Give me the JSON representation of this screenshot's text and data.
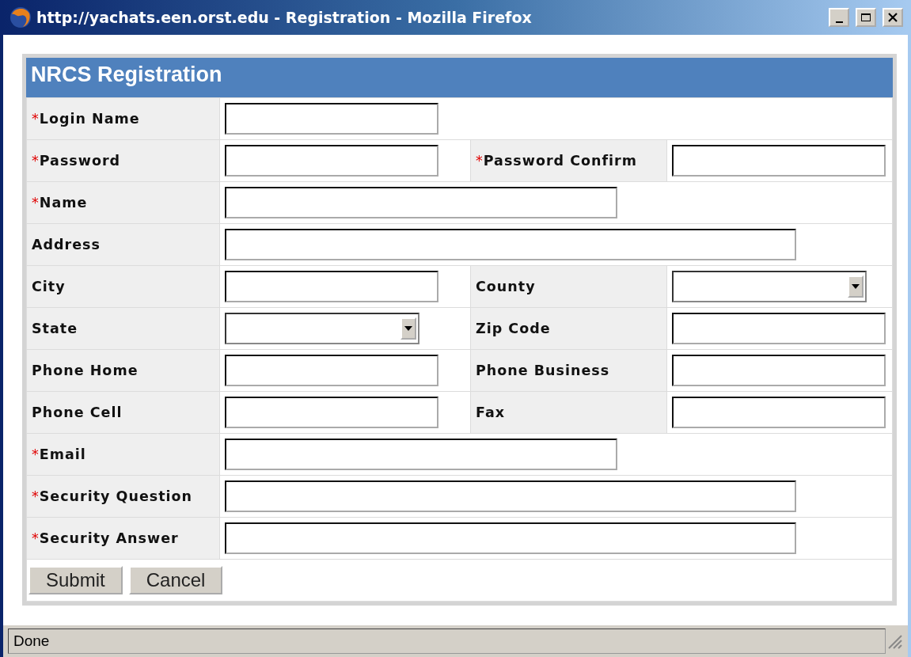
{
  "window": {
    "title": "http://yachats.een.orst.edu - Registration - Mozilla Firefox"
  },
  "form": {
    "title": "NRCS Registration",
    "rows": [
      {
        "fields": [
          {
            "label": "Login Name",
            "required": true,
            "kind": "text"
          }
        ]
      },
      {
        "fields": [
          {
            "label": "Password",
            "required": true,
            "kind": "text"
          },
          {
            "label": "Password Confirm",
            "required": true,
            "kind": "text"
          }
        ]
      },
      {
        "fields": [
          {
            "label": "Name",
            "required": true,
            "kind": "text"
          }
        ]
      },
      {
        "fields": [
          {
            "label": "Address",
            "required": false,
            "kind": "text"
          }
        ]
      },
      {
        "fields": [
          {
            "label": "City",
            "required": false,
            "kind": "text"
          },
          {
            "label": "County",
            "required": false,
            "kind": "select"
          }
        ]
      },
      {
        "fields": [
          {
            "label": "State",
            "required": false,
            "kind": "select"
          },
          {
            "label": "Zip Code",
            "required": false,
            "kind": "text"
          }
        ]
      },
      {
        "fields": [
          {
            "label": "Phone Home",
            "required": false,
            "kind": "text"
          },
          {
            "label": "Phone Business",
            "required": false,
            "kind": "text"
          }
        ]
      },
      {
        "fields": [
          {
            "label": "Phone Cell",
            "required": false,
            "kind": "text"
          },
          {
            "label": "Fax",
            "required": false,
            "kind": "text"
          }
        ]
      },
      {
        "fields": [
          {
            "label": "Email",
            "required": true,
            "kind": "text"
          }
        ]
      },
      {
        "fields": [
          {
            "label": "Security Question",
            "required": true,
            "kind": "text"
          }
        ]
      },
      {
        "fields": [
          {
            "label": "Security Answer",
            "required": true,
            "kind": "text"
          }
        ]
      }
    ],
    "required_mark": "*",
    "buttons": [
      "Submit",
      "Cancel"
    ]
  },
  "status_bar": {
    "text": "Done"
  }
}
